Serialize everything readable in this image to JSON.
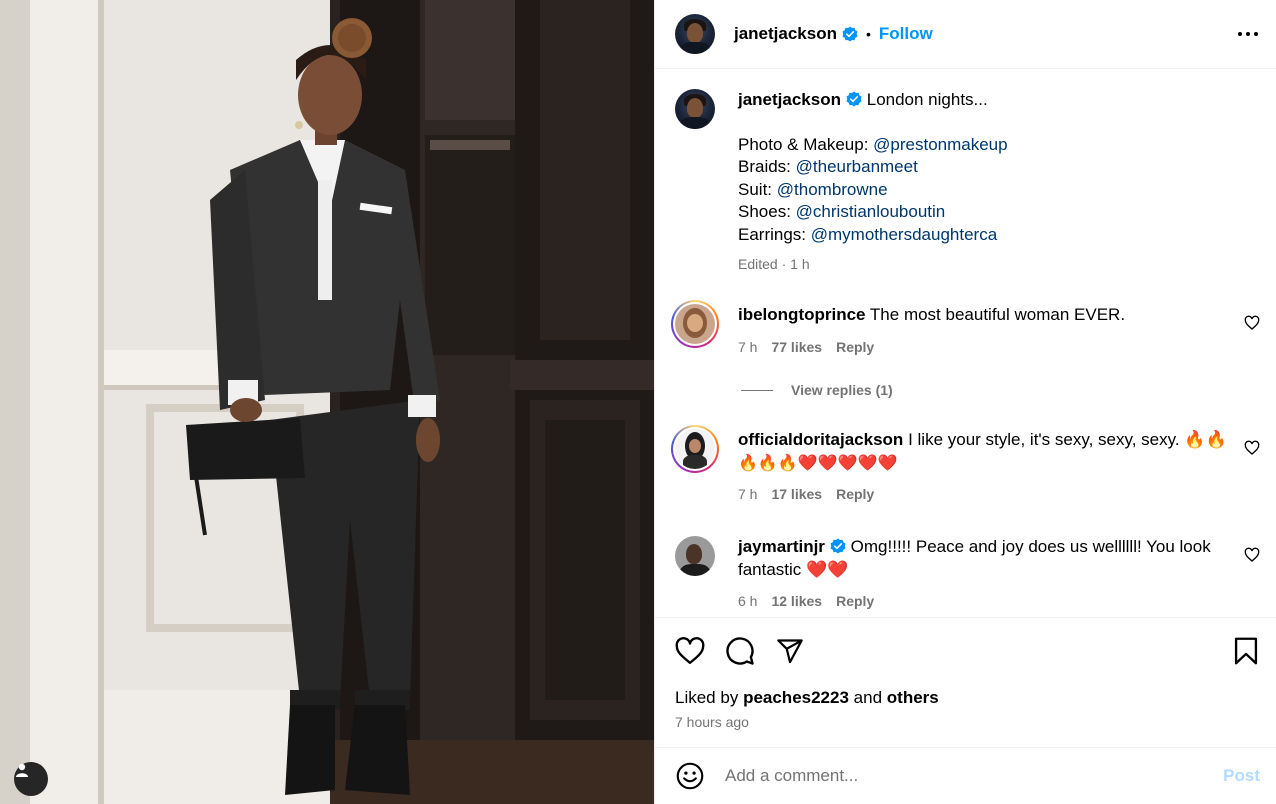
{
  "header": {
    "username": "janetjackson",
    "separator": "•",
    "follow_label": "Follow",
    "more_icon": "more-horizontal-icon"
  },
  "caption": {
    "username": "janetjackson",
    "text": "London nights...",
    "credits": [
      {
        "label": "Photo & Makeup:",
        "handle": "@prestonmakeup"
      },
      {
        "label": "Braids:",
        "handle": "@theurbanmeet"
      },
      {
        "label": "Suit:",
        "handle": "@thombrowne"
      },
      {
        "label": "Shoes:",
        "handle": "@christianlouboutin"
      },
      {
        "label": "Earrings:",
        "handle": "@mymothersdaughterca"
      }
    ],
    "meta": "Edited · 1 h"
  },
  "comments": [
    {
      "username": "ibelongtoprince",
      "text": "The most beautiful woman EVER.",
      "time": "7 h",
      "likes": "77 likes",
      "reply": "Reply"
    },
    {
      "username": "officialdoritajackson",
      "text": "I like your style, it's sexy, sexy, sexy. 🔥🔥",
      "text2": "🔥🔥🔥❤️❤️❤️❤️❤️",
      "time": "7 h",
      "likes": "17 likes",
      "reply": "Reply"
    },
    {
      "username": "jaymartinjr",
      "text": "Omg!!!!! Peace and joy does us wellllll! You look",
      "text2": "fantastic ❤️❤️",
      "time": "6 h",
      "likes": "12 likes",
      "reply": "Reply"
    }
  ],
  "view_replies": "View replies (1)",
  "likes": {
    "prefix": "Liked by",
    "user": "peaches2223",
    "and": "and",
    "others": "others"
  },
  "posted_ago": "7 hours ago",
  "add_comment": {
    "placeholder": "Add a comment...",
    "post_label": "Post"
  },
  "colors": {
    "accent": "#0095f6",
    "link": "#00376b",
    "secondary": "#737373"
  }
}
